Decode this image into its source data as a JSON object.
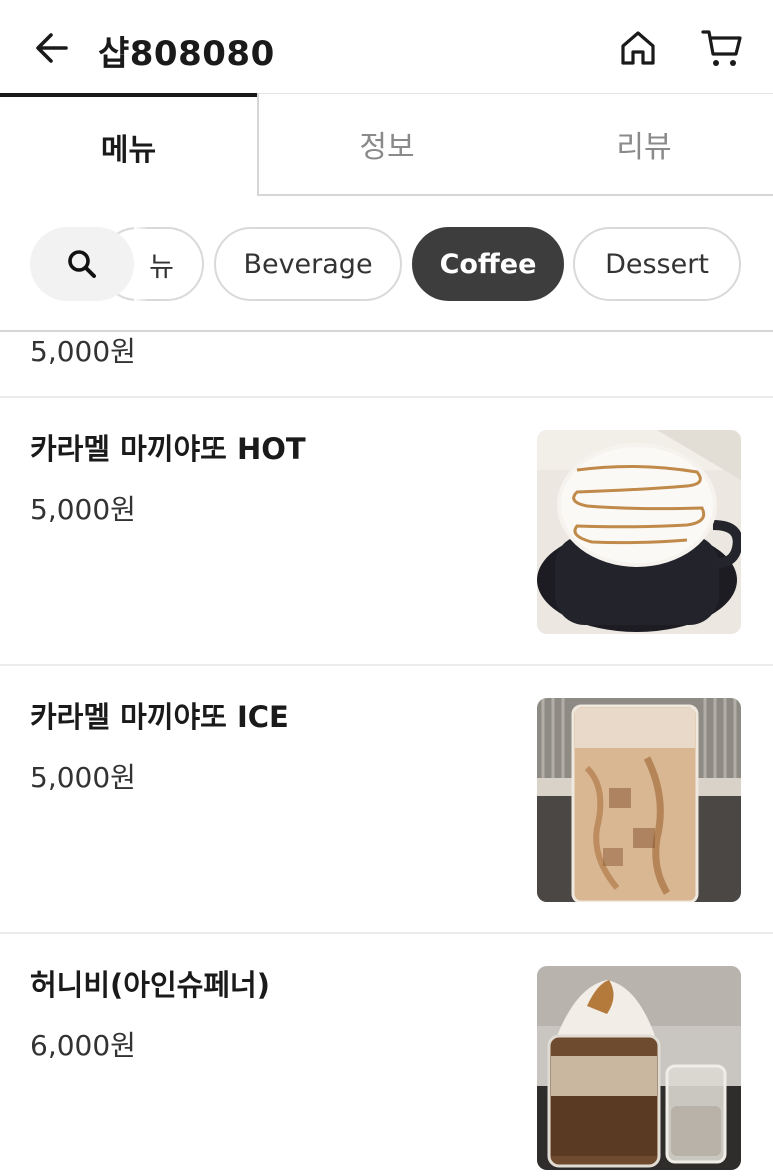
{
  "header": {
    "title": "샵808080",
    "back_icon": "arrow-left-icon",
    "home_icon": "home-icon",
    "cart_icon": "cart-icon"
  },
  "tabs": [
    {
      "label": "메뉴",
      "active": true
    },
    {
      "label": "정보",
      "active": false
    },
    {
      "label": "리뷰",
      "active": false
    }
  ],
  "categories": {
    "search_icon": "search-icon",
    "items": [
      {
        "label": "뉴",
        "active": false
      },
      {
        "label": "Beverage",
        "active": false
      },
      {
        "label": "Coffee",
        "active": true
      },
      {
        "label": "Dessert",
        "active": false
      }
    ],
    "active_color": "#3d3d3d"
  },
  "menu": {
    "partial_price": "5,000원",
    "items": [
      {
        "name": "카라멜 마끼야또 HOT",
        "price": "5,000원",
        "image": "caramel-macchiato-hot-photo"
      },
      {
        "name": "카라멜 마끼야또 ICE",
        "price": "5,000원",
        "image": "caramel-macchiato-ice-photo"
      },
      {
        "name": "허니비(아인슈페너)",
        "price": "6,000원",
        "image": "honeybee-einspanner-photo"
      }
    ]
  }
}
